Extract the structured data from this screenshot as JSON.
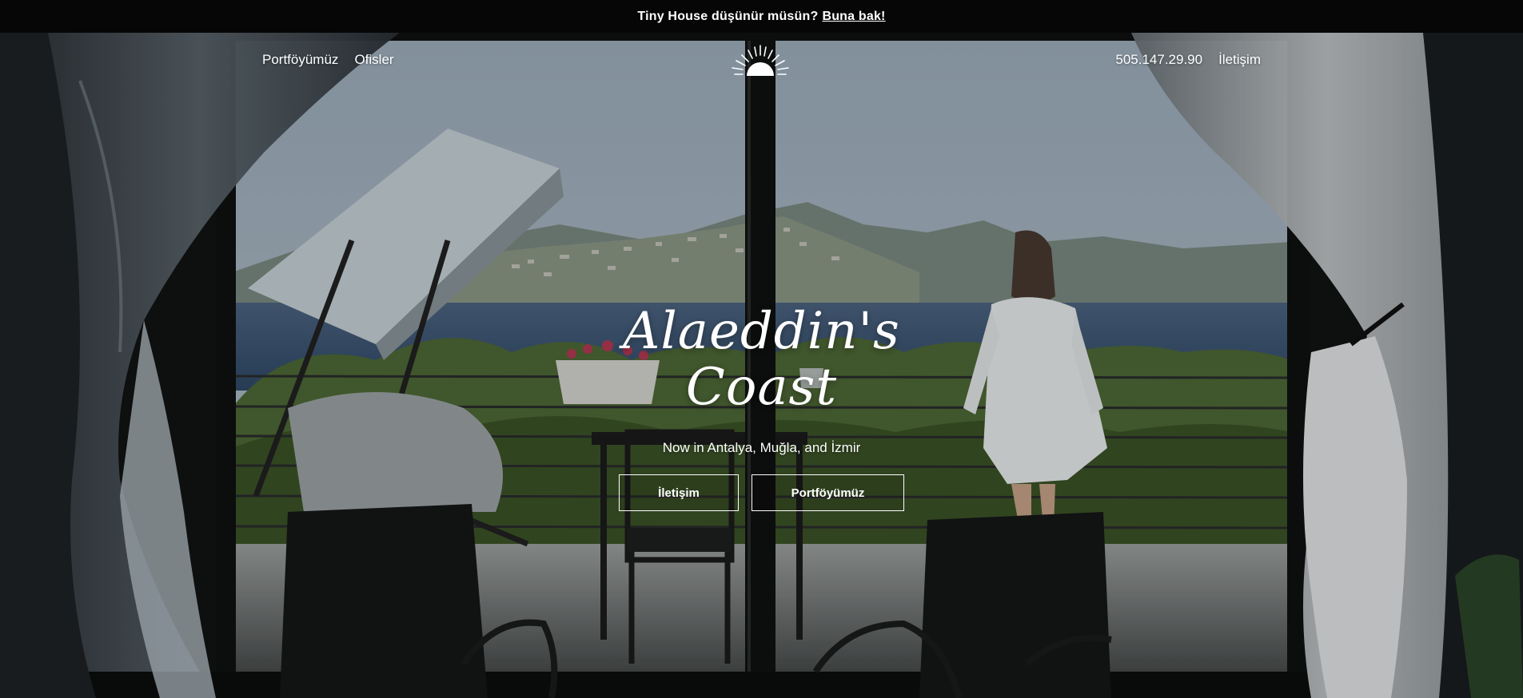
{
  "announcement": {
    "text": "Tiny House düşünür müsün?",
    "link_label": "Buna bak!"
  },
  "nav": {
    "left": [
      {
        "label": "Portföyümüz"
      },
      {
        "label": "Ofisler"
      }
    ],
    "right": [
      {
        "label": "505.147.29.90"
      },
      {
        "label": "İletişim"
      }
    ],
    "logo_icon": "sunrise-logo-icon"
  },
  "hero": {
    "title_line1": "Alaeddin's",
    "title_line2": "Coast",
    "subtitle": "Now in Antalya, Muğla, and İzmir",
    "buttons": [
      {
        "label": "İletişim"
      },
      {
        "label": "Portföyümüz"
      }
    ]
  },
  "colors": {
    "bar": "#060606",
    "text": "#ffffff",
    "sky": "#a9b7c4",
    "sea": "#3f5a79"
  }
}
